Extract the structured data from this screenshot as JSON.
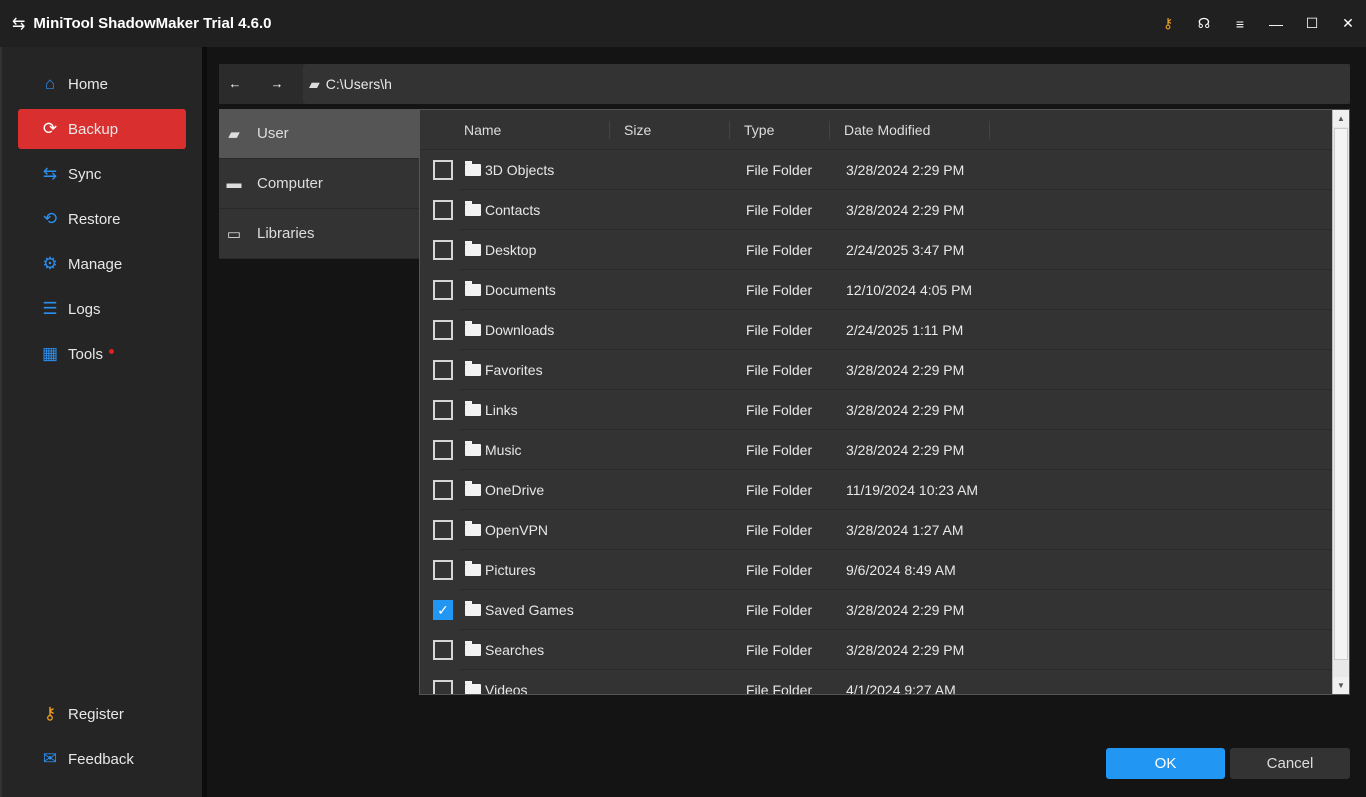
{
  "app": {
    "title": "MiniTool ShadowMaker Trial 4.6.0"
  },
  "sidebar": {
    "items": [
      {
        "label": "Home",
        "icon": "home-icon",
        "icon_glyph": "⌂"
      },
      {
        "label": "Backup",
        "icon": "backup-icon",
        "icon_glyph": "⟳"
      },
      {
        "label": "Sync",
        "icon": "sync-icon",
        "icon_glyph": "⇆"
      },
      {
        "label": "Restore",
        "icon": "restore-icon",
        "icon_glyph": "⟲"
      },
      {
        "label": "Manage",
        "icon": "manage-icon",
        "icon_glyph": "⚙"
      },
      {
        "label": "Logs",
        "icon": "logs-icon",
        "icon_glyph": "☰"
      },
      {
        "label": "Tools",
        "icon": "tools-icon",
        "icon_glyph": "▦"
      }
    ],
    "bottom": [
      {
        "label": "Register",
        "icon_glyph": "⚷"
      },
      {
        "label": "Feedback",
        "icon_glyph": "✉"
      }
    ]
  },
  "toolbar": {
    "back": "←",
    "forward": "→",
    "path": "C:\\Users\\h"
  },
  "locations": [
    {
      "label": "User"
    },
    {
      "label": "Computer"
    },
    {
      "label": "Libraries"
    }
  ],
  "columns": {
    "name": "Name",
    "size": "Size",
    "type": "Type",
    "date": "Date Modified"
  },
  "files": [
    {
      "name": "3D Objects",
      "type": "File Folder",
      "date": "3/28/2024 2:29 PM",
      "checked": false
    },
    {
      "name": "Contacts",
      "type": "File Folder",
      "date": "3/28/2024 2:29 PM",
      "checked": false
    },
    {
      "name": "Desktop",
      "type": "File Folder",
      "date": "2/24/2025 3:47 PM",
      "checked": false
    },
    {
      "name": "Documents",
      "type": "File Folder",
      "date": "12/10/2024 4:05 PM",
      "checked": false
    },
    {
      "name": "Downloads",
      "type": "File Folder",
      "date": "2/24/2025 1:11 PM",
      "checked": false
    },
    {
      "name": "Favorites",
      "type": "File Folder",
      "date": "3/28/2024 2:29 PM",
      "checked": false
    },
    {
      "name": "Links",
      "type": "File Folder",
      "date": "3/28/2024 2:29 PM",
      "checked": false
    },
    {
      "name": "Music",
      "type": "File Folder",
      "date": "3/28/2024 2:29 PM",
      "checked": false
    },
    {
      "name": "OneDrive",
      "type": "File Folder",
      "date": "11/19/2024 10:23 AM",
      "checked": false
    },
    {
      "name": "OpenVPN",
      "type": "File Folder",
      "date": "3/28/2024 1:27 AM",
      "checked": false
    },
    {
      "name": "Pictures",
      "type": "File Folder",
      "date": "9/6/2024 8:49 AM",
      "checked": false
    },
    {
      "name": "Saved Games",
      "type": "File Folder",
      "date": "3/28/2024 2:29 PM",
      "checked": true
    },
    {
      "name": "Searches",
      "type": "File Folder",
      "date": "3/28/2024 2:29 PM",
      "checked": false
    },
    {
      "name": "Videos",
      "type": "File Folder",
      "date": "4/1/2024 9:27 AM",
      "checked": false
    }
  ],
  "buttons": {
    "ok": "OK",
    "cancel": "Cancel"
  },
  "colors": {
    "accent": "#2196f3",
    "active_nav": "#d9302f",
    "key_icon": "#f0a020"
  }
}
